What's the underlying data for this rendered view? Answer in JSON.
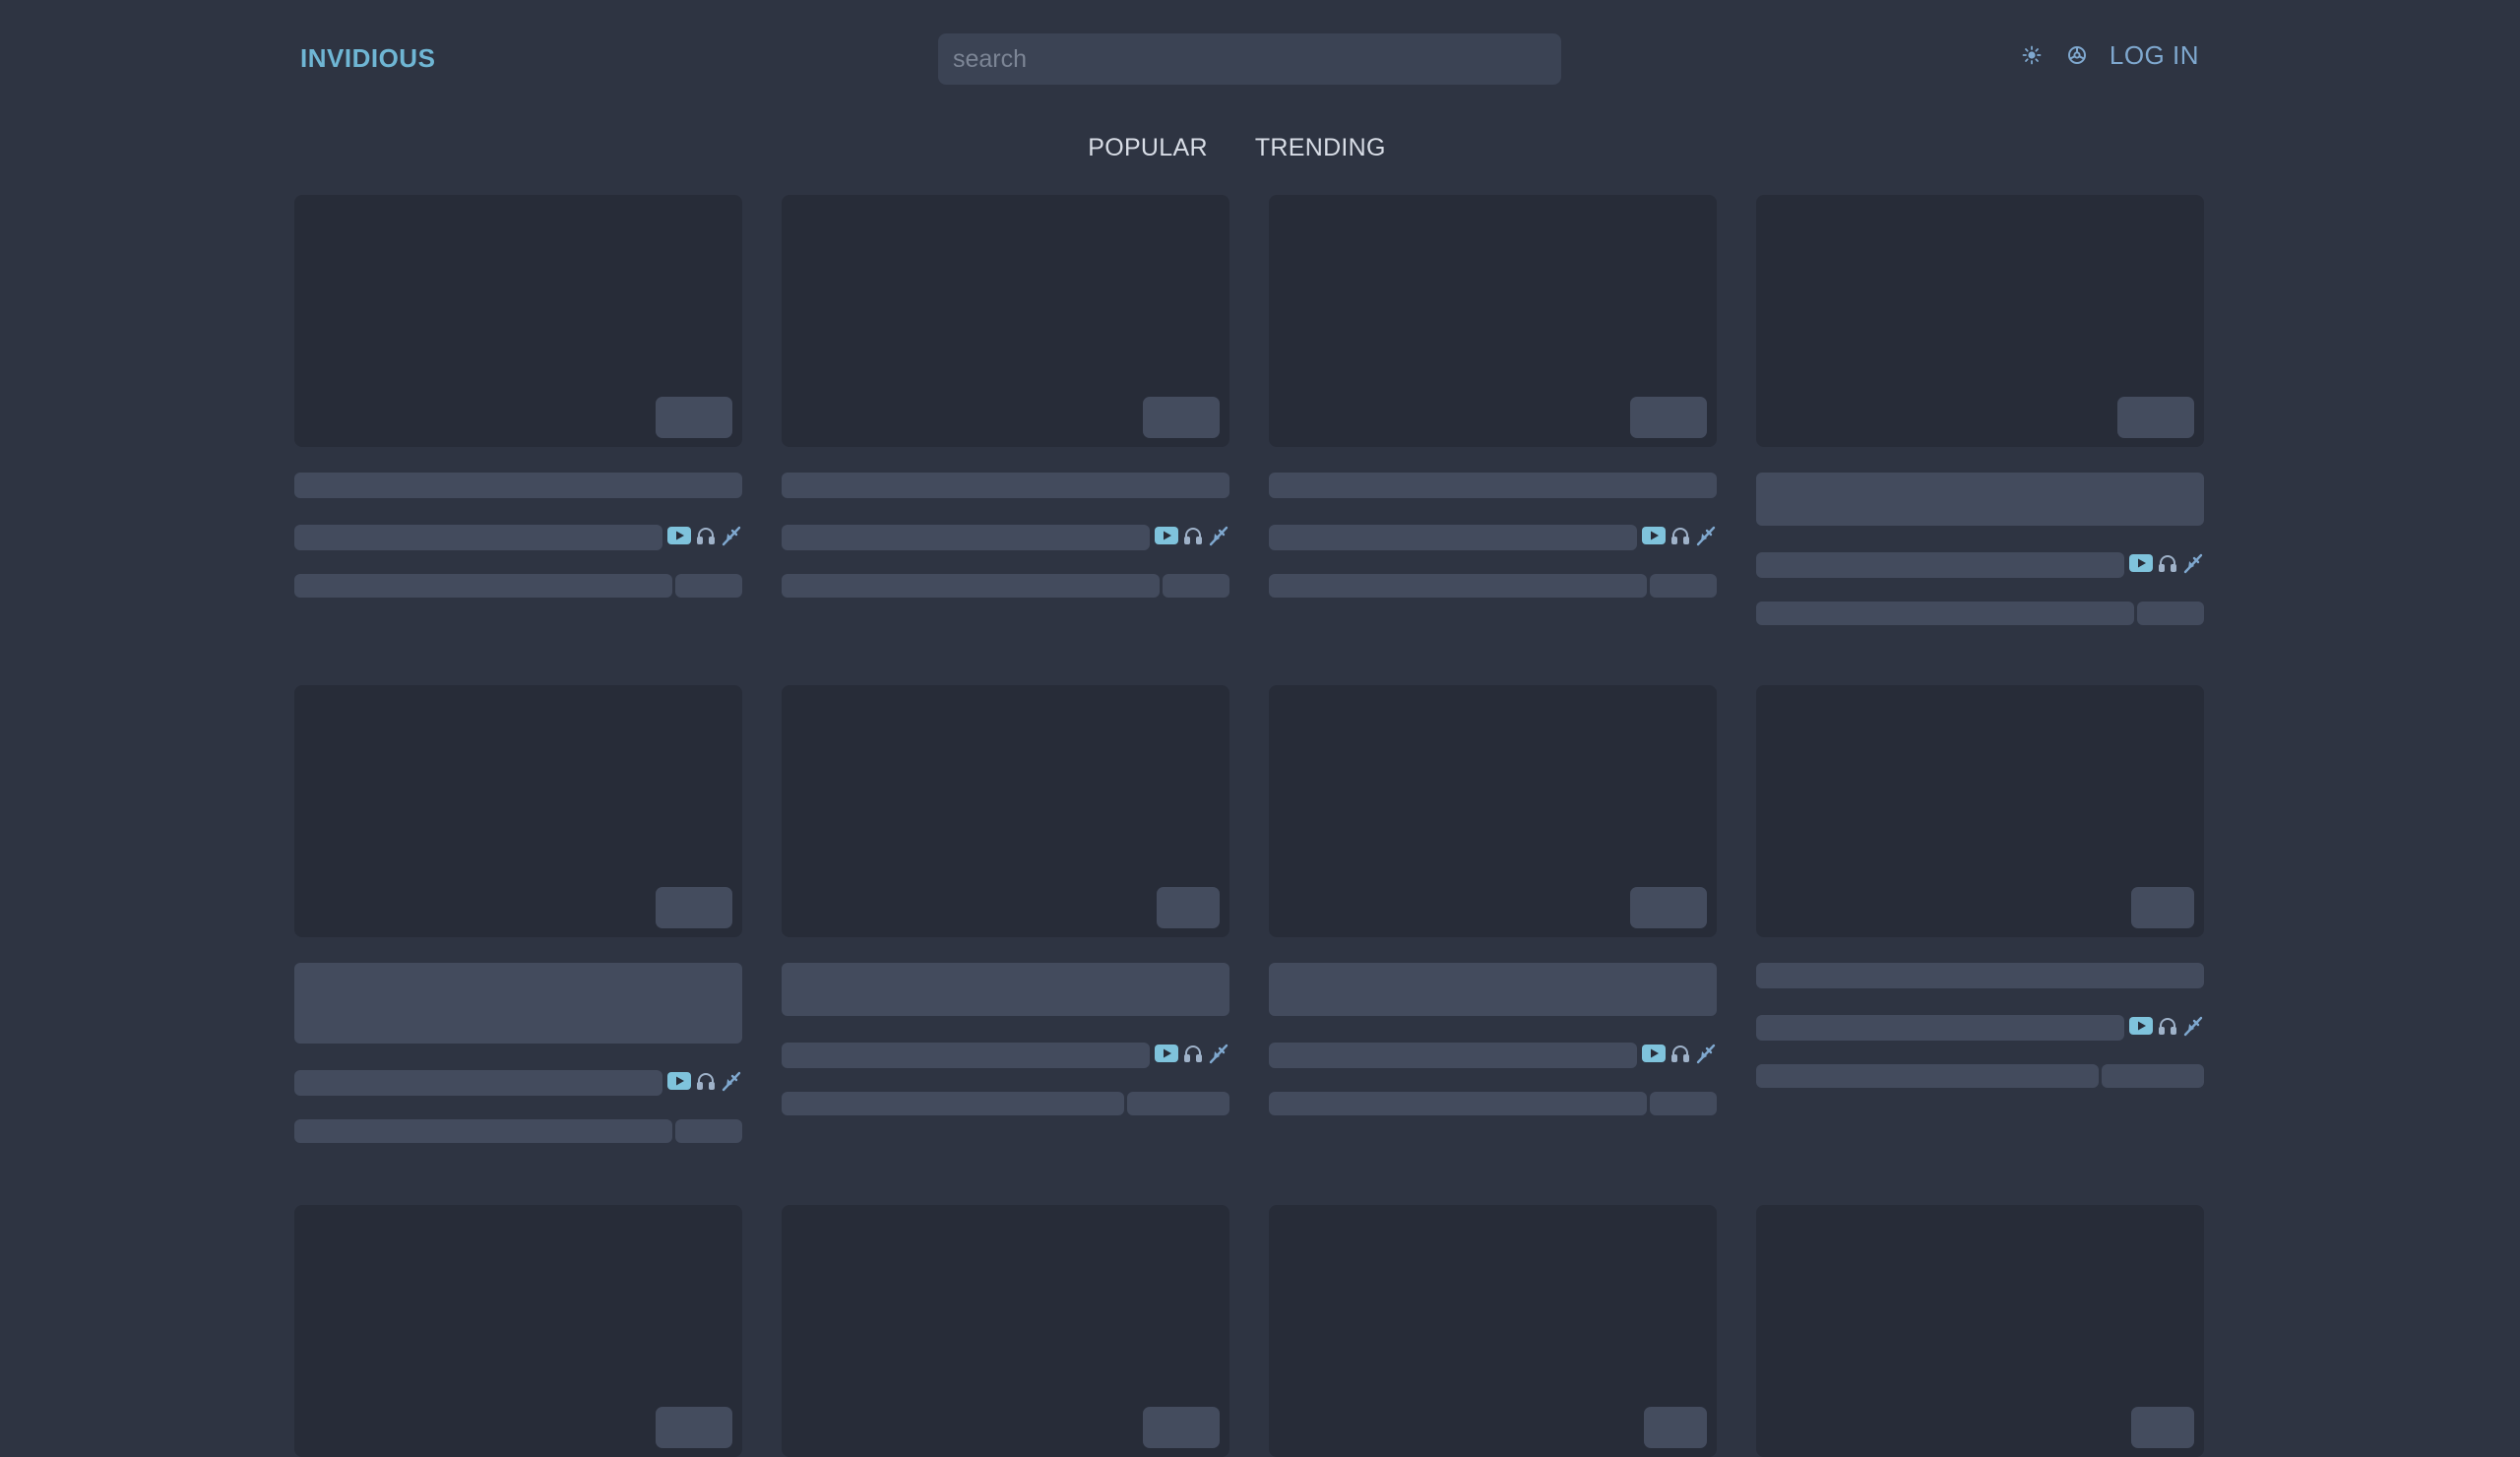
{
  "header": {
    "brand": "INVIDIOUS",
    "search_placeholder": "search",
    "theme_icon": "sun-icon",
    "preferences_icon": "gear-icon",
    "login_label": "LOG IN"
  },
  "tabs": [
    {
      "label": "POPULAR"
    },
    {
      "label": "TRENDING"
    }
  ],
  "colors": {
    "background": "#2e3442",
    "placeholder_block": "#434b5d",
    "thumbnail": "#272c38",
    "brand": "#6fb6d4",
    "link": "#7fa8cf"
  },
  "video_card_icons": [
    "youtube-icon",
    "headphones-icon",
    "redirect-icon"
  ]
}
